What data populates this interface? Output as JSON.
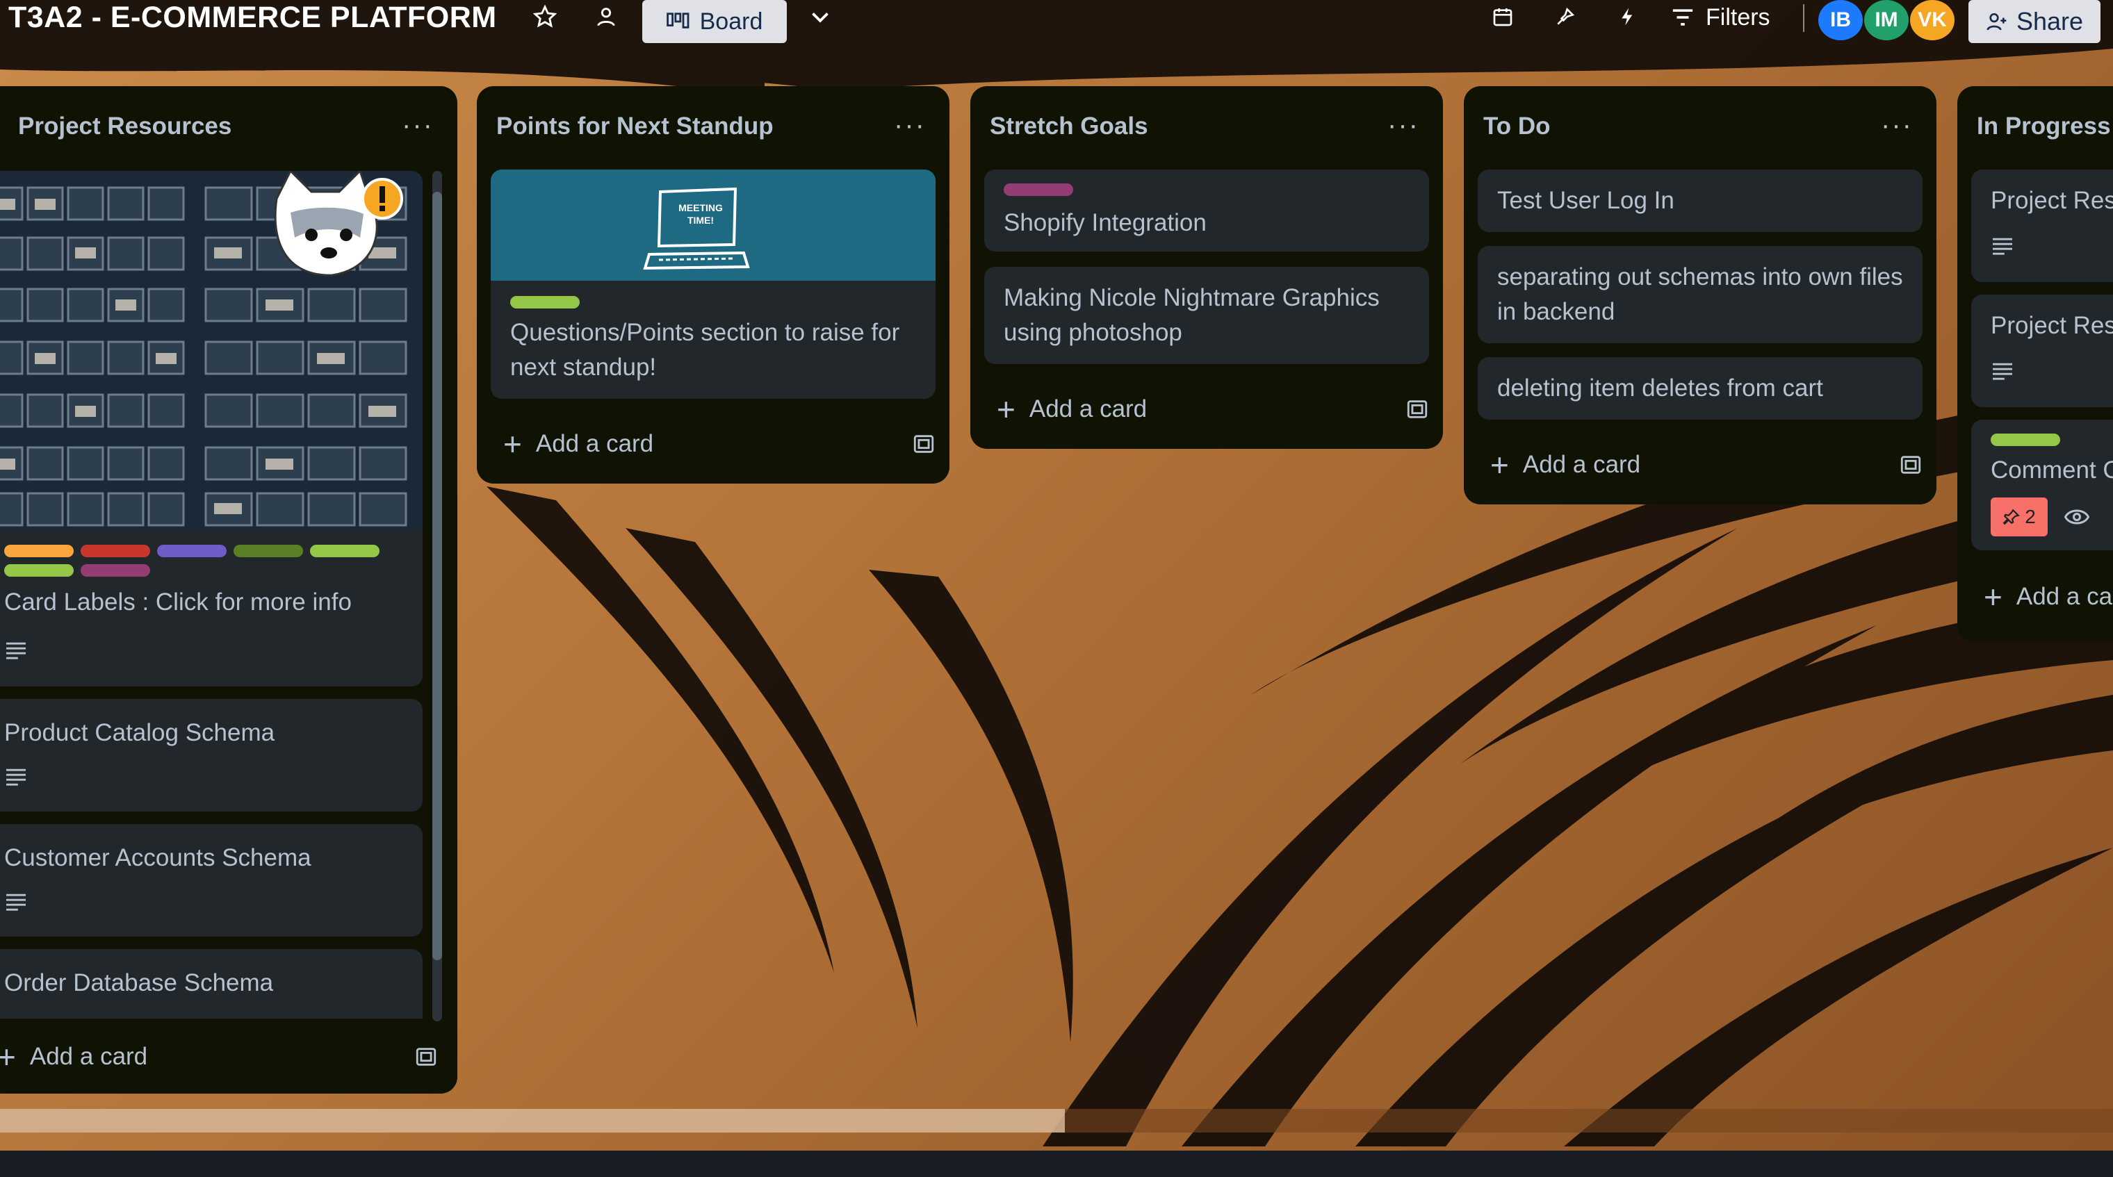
{
  "board": {
    "title": "T3A2 - E-COMMERCE PLATFORM",
    "view_label": "Board",
    "filters_label": "Filters",
    "share_label": "Share",
    "members": [
      {
        "initials": "IB",
        "color": "#1d7afc"
      },
      {
        "initials": "IM",
        "color": "#22a06b"
      },
      {
        "initials": "VK",
        "color": "#f5a623"
      }
    ]
  },
  "lists": [
    {
      "title": "Project Resources",
      "menu": "···",
      "cards": [
        {
          "title": "Card Labels : Click for more info",
          "labels": [
            "#faa53d",
            "#c9372c",
            "#6e5dc6",
            "#5b7f24",
            "#94c748",
            "#94c748",
            "#943d73"
          ]
        },
        {
          "title": "Product Catalog Schema"
        },
        {
          "title": "Customer Accounts Schema"
        },
        {
          "title": "Order Database Schema"
        }
      ],
      "add_label": "Add a card"
    },
    {
      "title": "Points for Next Standup",
      "menu": "···",
      "cards": [
        {
          "title": "Questions/Points section to raise for next standup!",
          "cover_color": "#1f6a83",
          "cover_text": "MEETING TIME!",
          "labels": [
            "#94c748"
          ]
        }
      ],
      "add_label": "Add a card"
    },
    {
      "title": "Stretch Goals",
      "menu": "···",
      "cards": [
        {
          "title": "Shopify Integration",
          "labels": [
            "#943d73"
          ]
        },
        {
          "title": "Making Nicole Nightmare Graphics using photoshop"
        }
      ],
      "add_label": "Add a card"
    },
    {
      "title": "To Do",
      "menu": "···",
      "cards": [
        {
          "title": "Test User Log In"
        },
        {
          "title": "separating out schemas into own files in backend"
        },
        {
          "title": "deleting item deletes from cart"
        }
      ],
      "add_label": "Add a card"
    },
    {
      "title": "In Progress",
      "cards": [
        {
          "title": "Project Res"
        },
        {
          "title": "Project Res"
        },
        {
          "title": "Comment C",
          "badge_count": "2",
          "labels": [
            "#94c748"
          ]
        }
      ],
      "add_label": "Add a ca"
    }
  ],
  "colors": {
    "list_bg": "#101204",
    "card_bg": "#22272b",
    "text": "#b6c2cf"
  }
}
